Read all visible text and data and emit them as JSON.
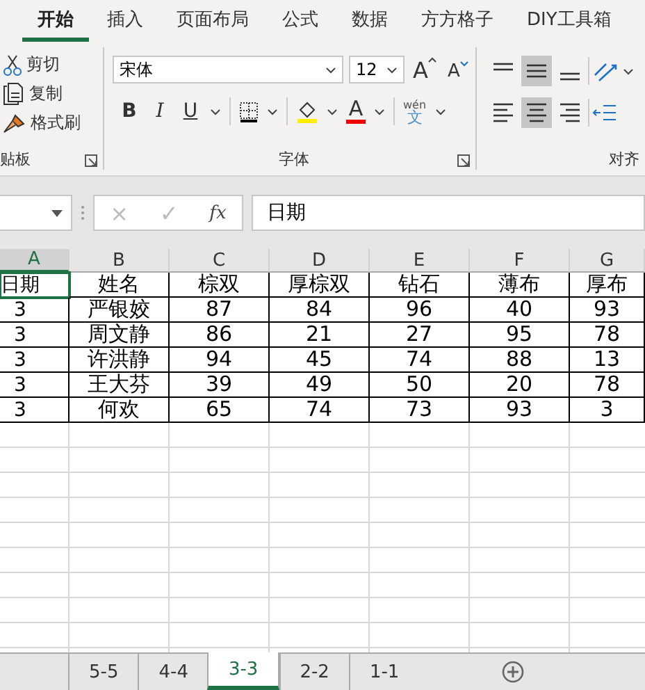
{
  "ribbon_tabs": [
    {
      "label": "开始",
      "selected": true
    },
    {
      "label": "插入",
      "selected": false
    },
    {
      "label": "页面布局",
      "selected": false
    },
    {
      "label": "公式",
      "selected": false
    },
    {
      "label": "数据",
      "selected": false
    },
    {
      "label": "方方格子",
      "selected": false
    },
    {
      "label": "DIY工具箱",
      "selected": false
    }
  ],
  "clipboard": {
    "items": [
      {
        "label": "剪切",
        "kind": "cut"
      },
      {
        "label": "复制",
        "kind": "copy"
      },
      {
        "label": "格式刷",
        "kind": "painter"
      }
    ],
    "group_label": "贴板"
  },
  "font": {
    "name": "宋体",
    "size": "12",
    "grow": "A",
    "shrink": "A",
    "bold": "B",
    "italic": "I",
    "underline": "U",
    "font_color": "A",
    "phonetic": "wén",
    "phonetic_char": "文",
    "group_label": "字体"
  },
  "alignment": {
    "vertical": [
      {
        "kind": "top",
        "selected": false
      },
      {
        "kind": "middle",
        "selected": true
      },
      {
        "kind": "bottom",
        "selected": false
      }
    ],
    "horizontal": [
      {
        "kind": "left",
        "selected": false
      },
      {
        "kind": "center",
        "selected": true
      },
      {
        "kind": "right",
        "selected": false
      }
    ],
    "group_label": "对齐"
  },
  "formula_bar": {
    "cancel": "×",
    "enter": "✓",
    "function": "fx",
    "value": "日期"
  },
  "sheet": {
    "columns": [
      {
        "label": "A",
        "selected": true
      },
      {
        "label": "B",
        "selected": false
      },
      {
        "label": "C",
        "selected": false
      },
      {
        "label": "D",
        "selected": false
      },
      {
        "label": "E",
        "selected": false
      },
      {
        "label": "F",
        "selected": false
      },
      {
        "label": "G",
        "selected": false
      }
    ],
    "rows": [
      [
        "日期",
        "姓名",
        "棕双",
        "厚棕双",
        "钻石",
        "薄布",
        "厚布"
      ],
      [
        "3",
        "严银姣",
        "87",
        "84",
        "96",
        "40",
        "93"
      ],
      [
        "3",
        "周文静",
        "86",
        "21",
        "27",
        "95",
        "78"
      ],
      [
        "3",
        "许洪静",
        "94",
        "45",
        "74",
        "88",
        "13"
      ],
      [
        "3",
        "王大芬",
        "39",
        "49",
        "50",
        "20",
        "78"
      ],
      [
        "3",
        "何欢",
        "65",
        "74",
        "73",
        "93",
        "3"
      ]
    ]
  },
  "sheet_tabs": [
    {
      "label": "5-5",
      "selected": false
    },
    {
      "label": "4-4",
      "selected": false
    },
    {
      "label": "3-3",
      "selected": true
    },
    {
      "label": "2-2",
      "selected": false
    },
    {
      "label": "1-1",
      "selected": false
    }
  ]
}
